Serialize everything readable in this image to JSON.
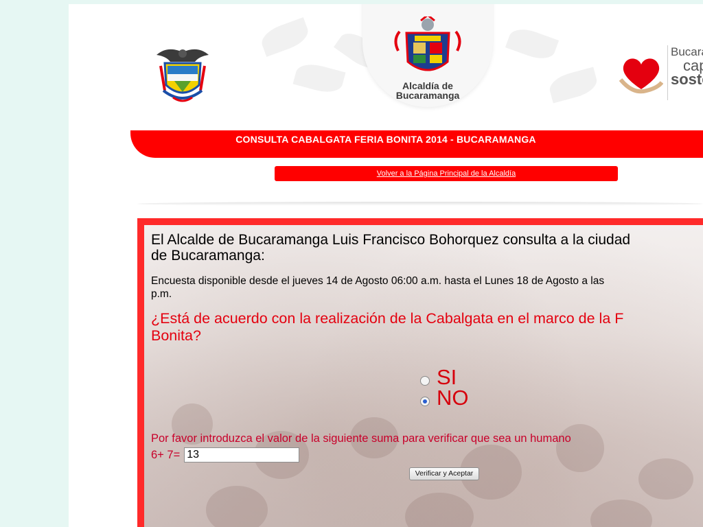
{
  "header": {
    "alcaldia_logo_text": [
      "Alcaldía de",
      "Bucaramanga"
    ],
    "right_logo_text": [
      "Bucara",
      "cap",
      "soste"
    ]
  },
  "title_bar": {
    "title": "CONSULTA CABALGATA FERIA BONITA 2014 - BUCARAMANGA",
    "back_link": "Volver a la Página Principal de la Alcaldía"
  },
  "survey": {
    "intro": [
      "El Alcalde de Bucaramanga Luis Francisco Bohorquez consulta a la ciudad",
      "de Bucaramanga:"
    ],
    "availability": [
      "Encuesta disponible desde el jueves 14 de Agosto 06:00 a.m. hasta el Lunes 18 de Agosto a las",
      "p.m."
    ],
    "question": [
      "¿Está de acuerdo con la realización de la Cabalgata en el marco de la F",
      "Bonita?"
    ],
    "options": [
      {
        "label": "SI",
        "selected": false
      },
      {
        "label": "NO",
        "selected": true
      }
    ],
    "captcha_prompt": "Por favor introduzca el valor de la siguiente suma para verificar que sea un humano",
    "sum_label": "6+ 7=",
    "sum_value": "13",
    "submit_label": "Verificar y Aceptar"
  },
  "colors": {
    "accent_red": "#ff0000",
    "question_red": "#e4000f",
    "page_background": "#e6f7f3"
  }
}
